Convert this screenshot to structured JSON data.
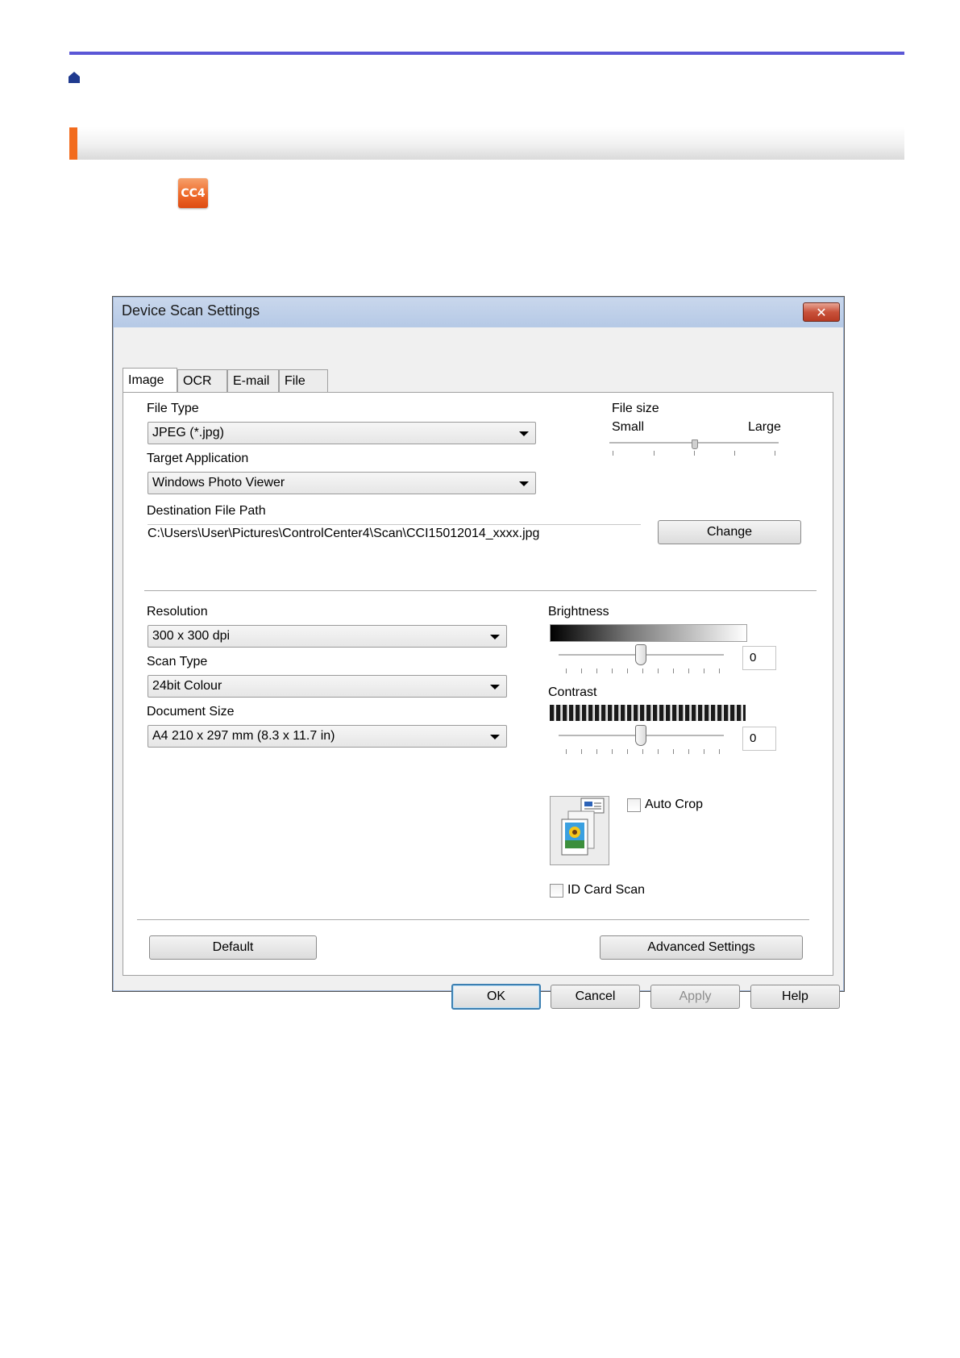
{
  "dialog": {
    "title": "Device Scan Settings",
    "close_label": "✕",
    "tabs": [
      "Image",
      "OCR",
      "E-mail",
      "File"
    ],
    "active_tab": "Image"
  },
  "app_icon_label": "CC4",
  "file_type": {
    "label": "File Type",
    "value": "JPEG (*.jpg)"
  },
  "target_application": {
    "label": "Target Application",
    "value": "Windows Photo Viewer"
  },
  "destination": {
    "label": "Destination File Path",
    "value": "C:\\Users\\User\\Pictures\\ControlCenter4\\Scan\\CCI15012014_xxxx.jpg",
    "change_button": "Change"
  },
  "file_size": {
    "label": "File size",
    "min_label": "Small",
    "max_label": "Large",
    "level_fraction": 0.5
  },
  "resolution": {
    "label": "Resolution",
    "value": "300 x 300 dpi"
  },
  "scan_type": {
    "label": "Scan Type",
    "value": "24bit Colour"
  },
  "document_size": {
    "label": "Document Size",
    "value": "A4 210 x 297 mm (8.3 x 11.7 in)"
  },
  "brightness": {
    "label": "Brightness",
    "value": "0",
    "level_fraction": 0.5
  },
  "contrast": {
    "label": "Contrast",
    "value": "0",
    "level_fraction": 0.5
  },
  "auto_crop": {
    "label": "Auto Crop",
    "checked": false
  },
  "id_card_scan": {
    "label": "ID Card Scan",
    "checked": false
  },
  "buttons": {
    "default": "Default",
    "advanced": "Advanced Settings",
    "ok": "OK",
    "cancel": "Cancel",
    "apply": "Apply",
    "help": "Help"
  },
  "colors": {
    "accent": "#f26b1d",
    "rule": "#5b57d6",
    "home_icon": "#1f3a8f"
  }
}
